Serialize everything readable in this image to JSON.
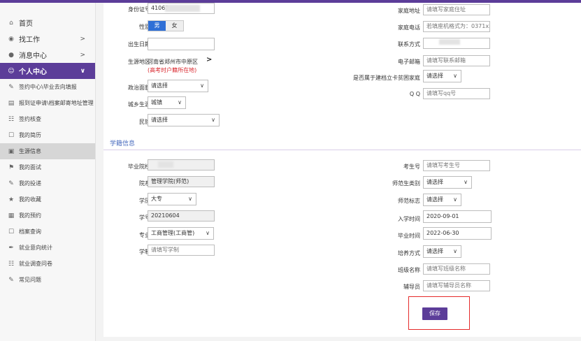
{
  "sidebar": {
    "items": [
      {
        "label": "首页",
        "icon": "bank-icon",
        "glyph": "⌂"
      },
      {
        "label": "找工作",
        "icon": "eye-icon",
        "glyph": "◉",
        "chev": ">"
      },
      {
        "label": "消息中心",
        "icon": "chat-icon",
        "glyph": "●",
        "chev": ">"
      },
      {
        "label": "个人中心",
        "icon": "user-icon",
        "glyph": "☺",
        "chev": "∨"
      }
    ],
    "subitems": [
      {
        "label": "签约中心\\毕业去向填报",
        "icon": "edit-icon",
        "glyph": "✎"
      },
      {
        "label": "报到证申请\\档案邮寄地址管理",
        "icon": "card-icon",
        "glyph": "▤"
      },
      {
        "label": "签约核查",
        "icon": "check-doc-icon",
        "glyph": "☷"
      },
      {
        "label": "我的简历",
        "icon": "resume-icon",
        "glyph": "☐"
      },
      {
        "label": "生源信息",
        "icon": "id-card-icon",
        "glyph": "▣"
      },
      {
        "label": "我的面试",
        "icon": "group-icon",
        "glyph": "⚑"
      },
      {
        "label": "我的投递",
        "icon": "send-icon",
        "glyph": "✎"
      },
      {
        "label": "我的收藏",
        "icon": "star-icon",
        "glyph": "★"
      },
      {
        "label": "我的预约",
        "icon": "calendar-icon",
        "glyph": "▦"
      },
      {
        "label": "档案查询",
        "icon": "archive-icon",
        "glyph": "☐"
      },
      {
        "label": "就业意向统计",
        "icon": "pen-icon",
        "glyph": "✒"
      },
      {
        "label": "就业调查问卷",
        "icon": "survey-icon",
        "glyph": "☷"
      },
      {
        "label": "常见问题",
        "icon": "question-icon",
        "glyph": "✎"
      }
    ]
  },
  "form": {
    "id_label": "身份证号",
    "id_value": "41062",
    "gender_label": "性别",
    "gender_male": "男",
    "gender_female": "女",
    "birth_label": "出生日期",
    "origin_label": "生源地区",
    "origin_value": "河南省郑州市中原区",
    "origin_note": "(高考时户籍所在地)",
    "origin_arrow": ">",
    "political_label": "政治面貌",
    "political_value": "请选择",
    "urban_label": "城乡生源",
    "urban_value": "城镇",
    "ethnic_label": "民族",
    "ethnic_value": "请选择",
    "home_addr_label": "家庭地址",
    "home_addr_ph": "请填写家庭住址",
    "home_phone_label": "家庭电话",
    "home_phone_ph": "若填座机格式为：0371xxxx",
    "contact_label": "联系方式",
    "email_label": "电子邮箱",
    "email_ph": "请填写联系邮箱",
    "poverty_label": "是否属于建档立卡贫困家庭",
    "poverty_value": "请选择",
    "qq_label": "Q Q",
    "qq_ph": "请填写qq号"
  },
  "section": {
    "title": "学籍信息"
  },
  "edu": {
    "school_label": "毕业院校",
    "dept_label": "院系",
    "dept_value": "管理学院(师范)",
    "degree_label": "学历",
    "degree_value": "大专",
    "stuno_label": "学号",
    "stuno_value": "20210604",
    "major_label": "专业",
    "major_value": "工商管理(工商管)",
    "years_label": "学制",
    "years_ph": "请填写学制",
    "exam_label": "考生号",
    "exam_ph": "请填写考生号",
    "normal_label": "师范生类别",
    "normal_value": "请选择",
    "normal_flag_label": "师范标志",
    "normal_flag_value": "请选择",
    "enroll_label": "入学时间",
    "enroll_value": "2020-09-01",
    "grad_label": "毕业时间",
    "grad_value": "2022-06-30",
    "train_label": "培养方式",
    "train_value": "请选择",
    "class_label": "班级名称",
    "class_ph": "请填写班级名称",
    "tutor_label": "辅导员",
    "tutor_ph": "请填写辅导员名称"
  },
  "actions": {
    "save_label": "保存"
  }
}
